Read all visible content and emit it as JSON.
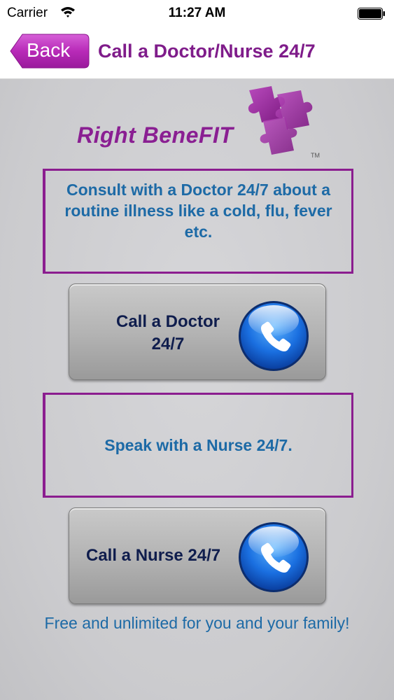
{
  "status_bar": {
    "carrier": "Carrier",
    "time": "11:27 AM"
  },
  "nav": {
    "back_label": "Back",
    "title": "Call a Doctor/Nurse 24/7"
  },
  "logo": {
    "text": "Right BeneFIT",
    "tm": "TM"
  },
  "sections": {
    "doctor_info": "Consult with a Doctor 24/7 about a routine illness like a cold, flu, fever etc.",
    "doctor_button_label": "Call a Doctor 24/7",
    "nurse_info": "Speak with a Nurse 24/7.",
    "nurse_button_label": "Call a Nurse 24/7"
  },
  "footer": {
    "text": "Free and unlimited for you and your family!"
  },
  "colors": {
    "brand_purple": "#8b1d8f",
    "info_blue": "#1d6aa6",
    "button_text": "#0f1d4d"
  },
  "icons": [
    "wifi-icon",
    "battery-icon",
    "phone-icon"
  ]
}
